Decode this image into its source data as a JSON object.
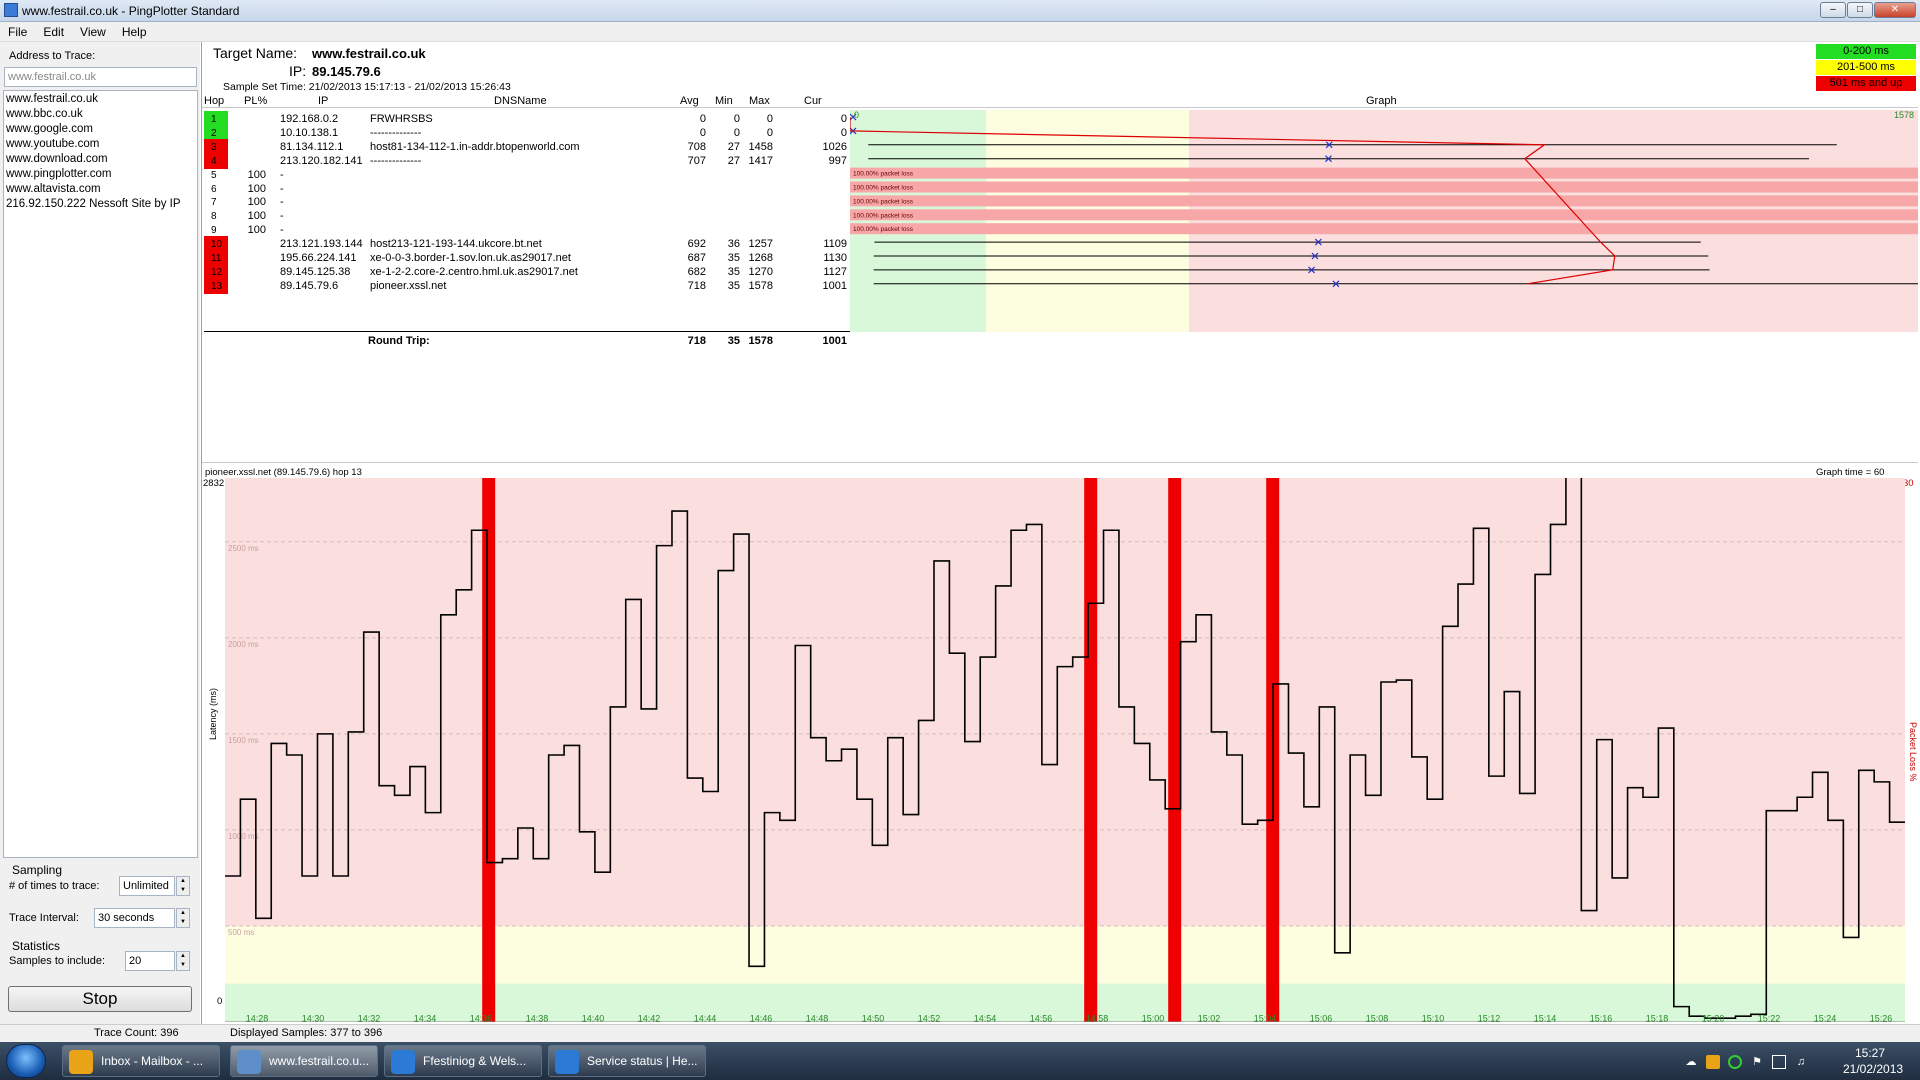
{
  "window": {
    "title": "www.festrail.co.uk - PingPlotter Standard",
    "min": "–",
    "max": "□",
    "close": "✕"
  },
  "menu": [
    "File",
    "Edit",
    "View",
    "Help"
  ],
  "left": {
    "address_label": "Address to Trace:",
    "address_value": "www.festrail.co.uk",
    "history": [
      "www.festrail.co.uk",
      "www.bbc.co.uk",
      "www.google.com",
      "www.youtube.com",
      "www.download.com",
      "www.pingplotter.com",
      "www.altavista.com",
      "216.92.150.222 Nessoft Site by IP"
    ],
    "sampling_label": "Sampling",
    "times_label": "# of times to trace:",
    "times_value": "Unlimited",
    "interval_label": "Trace Interval:",
    "interval_value": "30 seconds",
    "statistics_label": "Statistics",
    "samples_label": "Samples to include:",
    "samples_value": "20",
    "stop_label": "Stop",
    "trace_count": "Trace Count: 396"
  },
  "target": {
    "name_label": "Target Name:",
    "name": "www.festrail.co.uk",
    "ip_label": "IP:",
    "ip": "89.145.79.6",
    "sample_time": "Sample Set Time:  21/02/2013 15:17:13 - 21/02/2013 15:26:43"
  },
  "legend": [
    {
      "label": "0-200 ms",
      "color": "#22dd22",
      "text": "#000000"
    },
    {
      "label": "201-500 ms",
      "color": "#ffff00",
      "text": "#000000"
    },
    {
      "label": "501 ms and up",
      "color": "#ee0000",
      "text": "#000000"
    }
  ],
  "table": {
    "headers": {
      "hop": "Hop",
      "pl": "PL%",
      "ip": "IP",
      "dns": "DNSName",
      "avg": "Avg",
      "min": "Min",
      "max": "Max",
      "cur": "Cur",
      "graph": "Graph"
    },
    "scale_left": "0",
    "scale_right": "1578",
    "packet_loss_text": "100.00% packet loss",
    "rows": [
      {
        "hop": "1",
        "pl": "",
        "ip": "192.168.0.2",
        "dns": "FRWHRSBS",
        "avg": "0",
        "min": "0",
        "max": "0",
        "cur": "0",
        "status": "green"
      },
      {
        "hop": "2",
        "pl": "",
        "ip": "10.10.138.1",
        "dns": "--------------",
        "avg": "0",
        "min": "0",
        "max": "0",
        "cur": "0",
        "status": "green"
      },
      {
        "hop": "3",
        "pl": "",
        "ip": "81.134.112.1",
        "dns": "host81-134-112-1.in-addr.btopenworld.com",
        "avg": "708",
        "min": "27",
        "max": "1458",
        "cur": "1026",
        "status": "red"
      },
      {
        "hop": "4",
        "pl": "",
        "ip": "213.120.182.141",
        "dns": "--------------",
        "avg": "707",
        "min": "27",
        "max": "1417",
        "cur": "997",
        "status": "red"
      },
      {
        "hop": "5",
        "pl": "100",
        "ip": "-",
        "dns": "",
        "avg": "",
        "min": "",
        "max": "",
        "cur": "",
        "status": "none"
      },
      {
        "hop": "6",
        "pl": "100",
        "ip": "-",
        "dns": "",
        "avg": "",
        "min": "",
        "max": "",
        "cur": "",
        "status": "none"
      },
      {
        "hop": "7",
        "pl": "100",
        "ip": "-",
        "dns": "",
        "avg": "",
        "min": "",
        "max": "",
        "cur": "",
        "status": "none"
      },
      {
        "hop": "8",
        "pl": "100",
        "ip": "-",
        "dns": "",
        "avg": "",
        "min": "",
        "max": "",
        "cur": "",
        "status": "none"
      },
      {
        "hop": "9",
        "pl": "100",
        "ip": "-",
        "dns": "",
        "avg": "",
        "min": "",
        "max": "",
        "cur": "",
        "status": "none"
      },
      {
        "hop": "10",
        "pl": "",
        "ip": "213.121.193.144",
        "dns": "host213-121-193-144.ukcore.bt.net",
        "avg": "692",
        "min": "36",
        "max": "1257",
        "cur": "1109",
        "status": "red"
      },
      {
        "hop": "11",
        "pl": "",
        "ip": "195.66.224.141",
        "dns": "xe-0-0-3.border-1.sov.lon.uk.as29017.net",
        "avg": "687",
        "min": "35",
        "max": "1268",
        "cur": "1130",
        "status": "red"
      },
      {
        "hop": "12",
        "pl": "",
        "ip": "89.145.125.38",
        "dns": "xe-1-2-2.core-2.centro.hml.uk.as29017.net",
        "avg": "682",
        "min": "35",
        "max": "1270",
        "cur": "1127",
        "status": "red"
      },
      {
        "hop": "13",
        "pl": "",
        "ip": "89.145.79.6",
        "dns": "pioneer.xssl.net",
        "avg": "718",
        "min": "35",
        "max": "1578",
        "cur": "1001",
        "status": "red"
      }
    ],
    "roundtrip": {
      "label": "Round Trip:",
      "avg": "718",
      "min": "35",
      "max": "1578",
      "cur": "1001"
    }
  },
  "chart_data": {
    "type": "line",
    "title": "pioneer.xssl.net (89.145.79.6) hop 13",
    "graph_time": "Graph time = 60 minutes",
    "ylabel": "Latency (ms)",
    "y2label": "Packet Loss %",
    "ymax_label": "2832",
    "y2max_label": "30",
    "ymin_label": "0",
    "ylim": [
      0,
      2832
    ],
    "gridlines": [
      {
        "v": 500,
        "label": "500 ms"
      },
      {
        "v": 1000,
        "label": "1000 ms"
      },
      {
        "v": 1500,
        "label": "1500 ms"
      },
      {
        "v": 2000,
        "label": "2000 ms"
      },
      {
        "v": 2500,
        "label": "2500 ms"
      }
    ],
    "zones": [
      {
        "from": 0,
        "to": 200,
        "color": "#d9f7d9"
      },
      {
        "from": 200,
        "to": 500,
        "color": "#fdfde0"
      },
      {
        "from": 500,
        "to": 2832,
        "color": "#fbdede"
      }
    ],
    "x_ticks": [
      "14:28",
      "14:30",
      "14:32",
      "14:34",
      "14:36",
      "14:38",
      "14:40",
      "14:42",
      "14:44",
      "14:46",
      "14:48",
      "14:50",
      "14:52",
      "14:54",
      "14:56",
      "14:58",
      "15:00",
      "15:02",
      "15:04",
      "15:06",
      "15:08",
      "15:10",
      "15:12",
      "15:14",
      "15:16",
      "15:18",
      "15:20",
      "15:22",
      "15:24",
      "15:26"
    ],
    "x_range_minutes": [
      0,
      60
    ],
    "loss_minutes": [
      9.4,
      30.9,
      33.9,
      37.4
    ],
    "values": [
      760,
      1160,
      540,
      1450,
      1390,
      760,
      1500,
      760,
      1510,
      2030,
      1230,
      1180,
      1330,
      1090,
      2120,
      2250,
      2560,
      830,
      850,
      1010,
      850,
      1390,
      1440,
      990,
      780,
      1640,
      2200,
      1630,
      2480,
      2660,
      1270,
      1200,
      2350,
      2540,
      290,
      1090,
      1050,
      1960,
      1480,
      1360,
      1420,
      1160,
      920,
      1480,
      1080,
      1570,
      2400,
      1920,
      1460,
      1900,
      2270,
      2560,
      2590,
      1340,
      1850,
      1900,
      2180,
      2560,
      1640,
      1450,
      1260,
      1110,
      1980,
      2120,
      1510,
      1390,
      1030,
      1050,
      1760,
      1400,
      1120,
      1640,
      360,
      1390,
      1180,
      1770,
      1780,
      1380,
      1160,
      2060,
      2280,
      2570,
      1280,
      1720,
      1190,
      2330,
      2590,
      2860,
      580,
      1470,
      750,
      1220,
      1170,
      1530,
      80,
      30,
      20,
      20,
      30,
      40,
      1100,
      1100,
      1170,
      1300,
      1050,
      440,
      1310,
      1250,
      1040
    ]
  },
  "status": {
    "displayed": "Displayed Samples: 377 to 396"
  },
  "taskbar": {
    "items": [
      {
        "label": "Inbox - Mailbox - ...",
        "icon": "outlook-icon",
        "color": "#e8a317"
      },
      {
        "label": "www.festrail.co.u...",
        "icon": "pingplotter-icon",
        "color": "#5f8fc8"
      },
      {
        "label": "Ffestiniog & Wels...",
        "icon": "ie-icon",
        "color": "#2b7ad6"
      },
      {
        "label": "Service status | He...",
        "icon": "ie-icon",
        "color": "#2b7ad6"
      }
    ],
    "time": "15:27",
    "date": "21/02/2013"
  }
}
